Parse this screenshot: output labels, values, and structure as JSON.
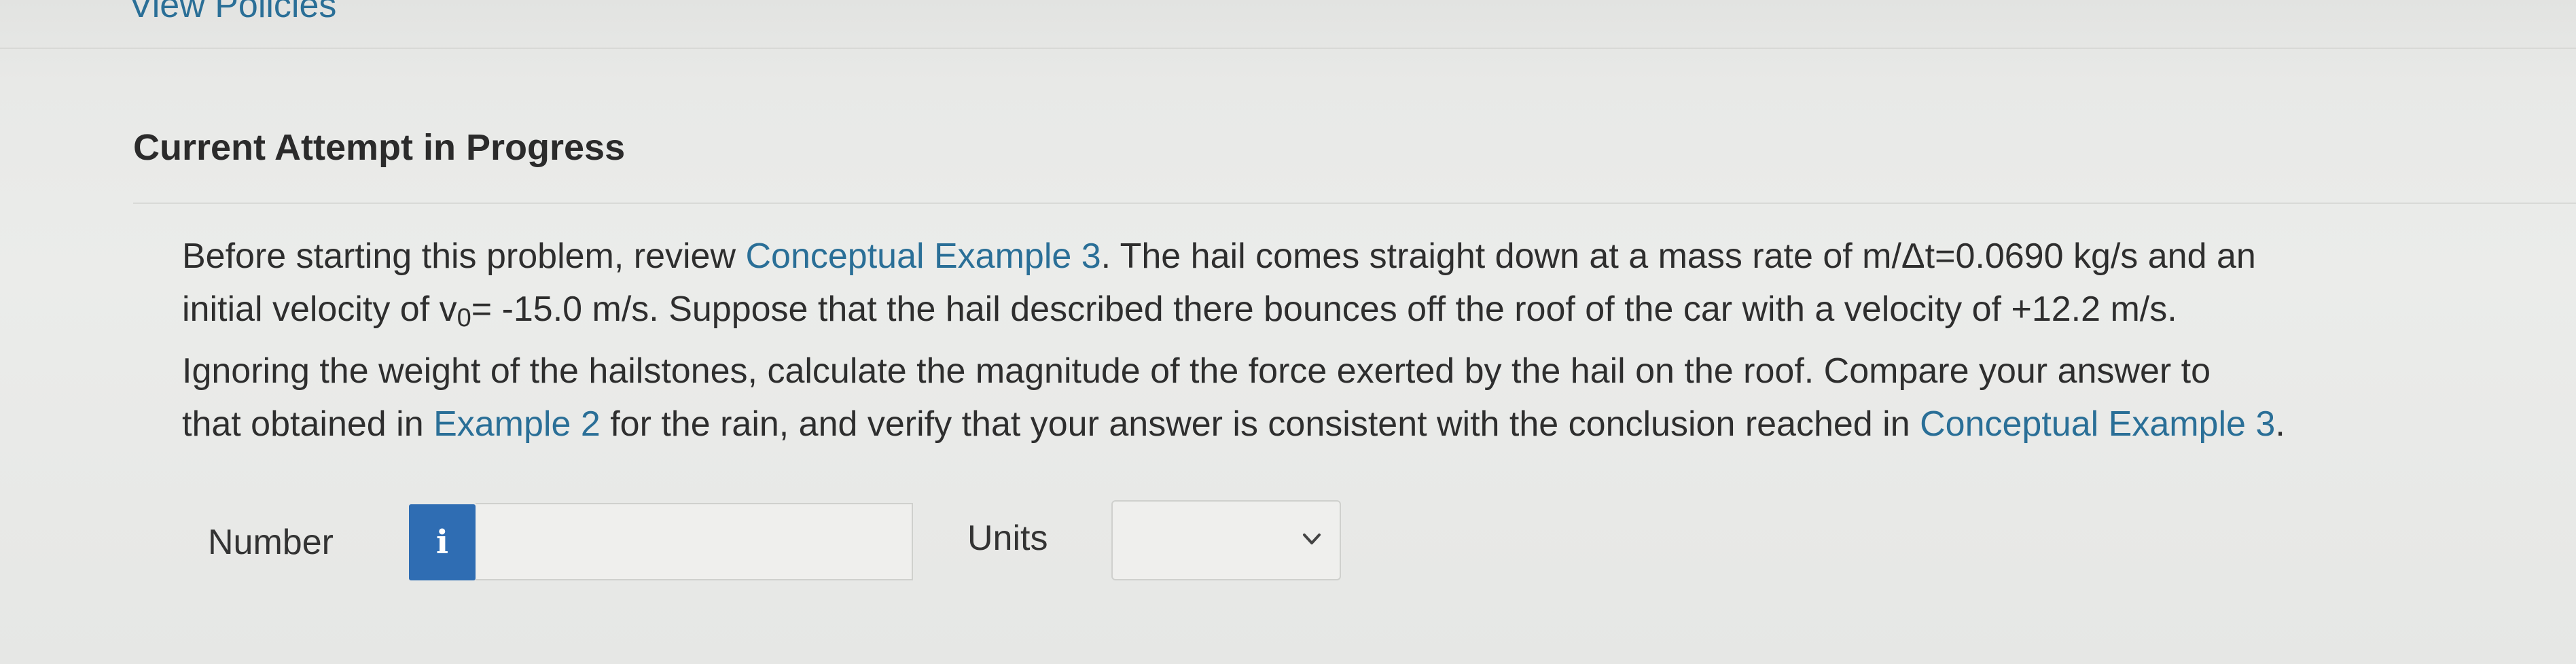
{
  "header": {
    "view_policies_link": "View Policies"
  },
  "question": {
    "heading": "Current Attempt in Progress",
    "line1_pre": "Before starting this problem, review ",
    "line1_link": "Conceptual Example 3",
    "line1_post": ". The hail comes straight down at a mass rate of m/Δt=0.0690 kg/s and an",
    "line2_pre": "initial velocity of v",
    "line2_sub": "0",
    "line2_post": "= -15.0 m/s. Suppose that the hail described there bounces off the roof of the car with a velocity of +12.2 m/s.",
    "line3": "Ignoring the weight of the hailstones, calculate the magnitude of the force exerted by the hail on the roof. Compare your answer to",
    "line4_pre": "that obtained in ",
    "line4_link1": "Example 2",
    "line4_mid": " for the rain, and verify that your answer is consistent with the conclusion reached in ",
    "line4_link2": "Conceptual Example 3",
    "line4_post": "."
  },
  "answer": {
    "number_label": "Number",
    "info_button": "i",
    "number_value": "",
    "units_label": "Units",
    "units_selected": ""
  },
  "icons": {
    "info": "info-icon",
    "dropdown": "chevron-down-icon"
  }
}
